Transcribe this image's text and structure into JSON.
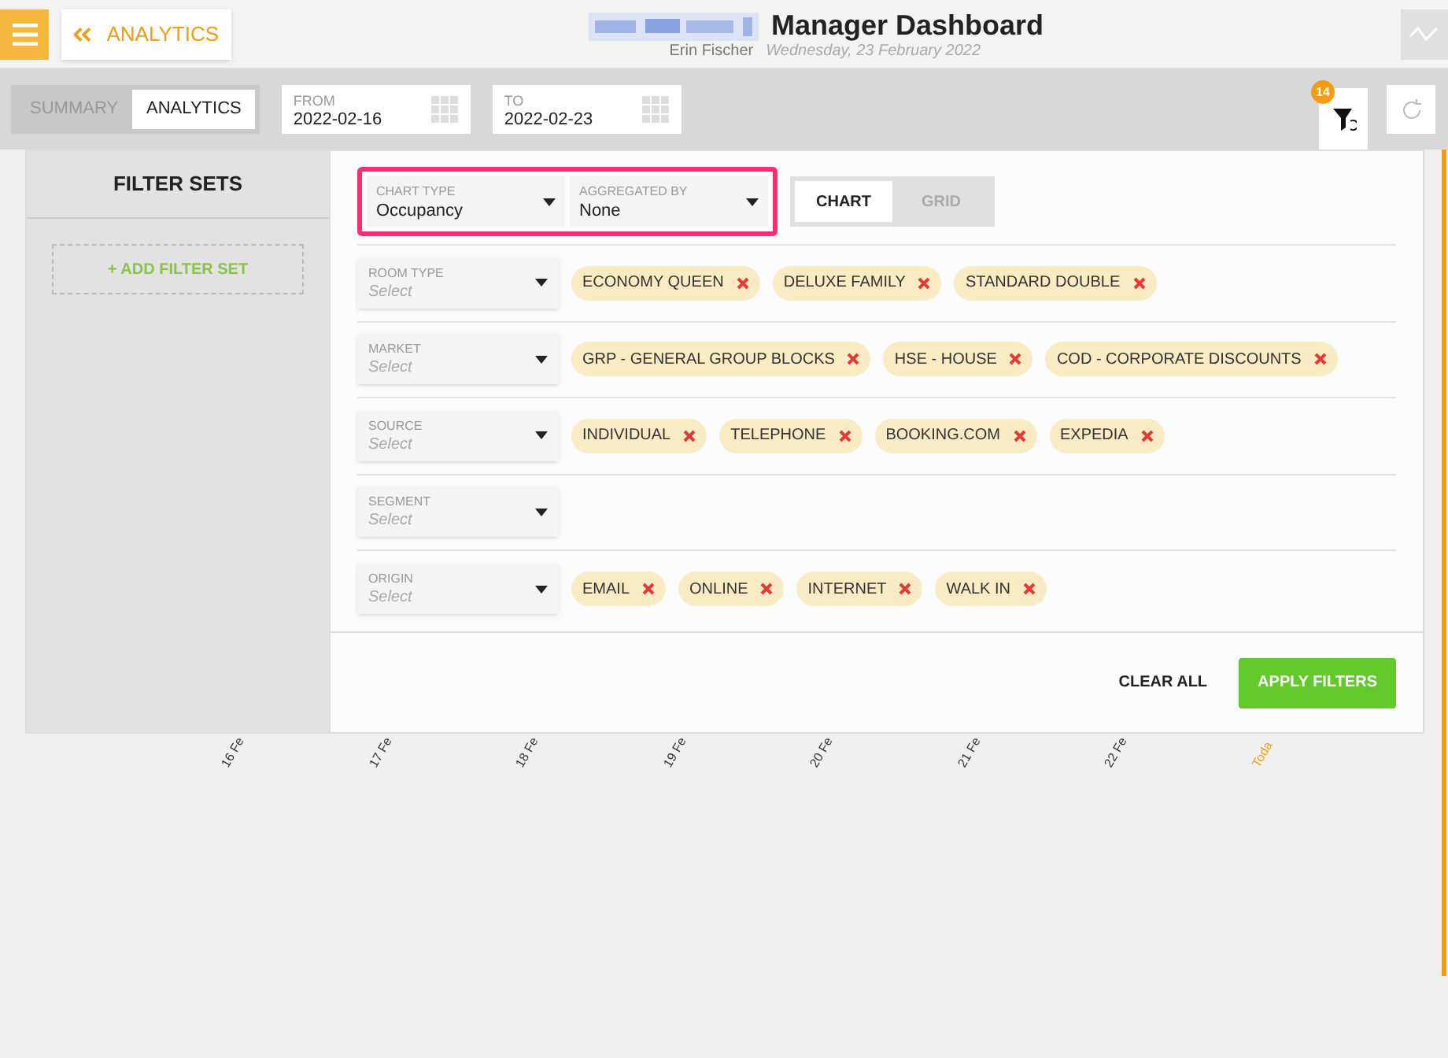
{
  "header": {
    "back_label": "ANALYTICS",
    "title": "Manager Dashboard",
    "user": "Erin Fischer",
    "date": "Wednesday, 23 February 2022"
  },
  "view_tabs": [
    {
      "label": "SUMMARY",
      "selected": false
    },
    {
      "label": "ANALYTICS",
      "selected": true
    }
  ],
  "date_from": {
    "label": "FROM",
    "value": "2022-02-16"
  },
  "date_to": {
    "label": "TO",
    "value": "2022-02-23"
  },
  "filter_badge": "14",
  "filter_sets": {
    "title": "FILTER SETS",
    "add_label": "+ ADD FILTER SET"
  },
  "chart_type": {
    "label": "CHART TYPE",
    "value": "Occupancy"
  },
  "aggregated_by": {
    "label": "AGGREGATED BY",
    "value": "None"
  },
  "display_tabs": [
    {
      "label": "CHART",
      "selected": true
    },
    {
      "label": "GRID",
      "selected": false
    }
  ],
  "filters": [
    {
      "label": "ROOM TYPE",
      "placeholder": "Select",
      "tags": [
        "ECONOMY QUEEN",
        "DELUXE FAMILY",
        "STANDARD DOUBLE"
      ]
    },
    {
      "label": "MARKET",
      "placeholder": "Select",
      "tags": [
        "GRP - GENERAL GROUP BLOCKS",
        "HSE - HOUSE",
        "COD - CORPORATE DISCOUNTS"
      ]
    },
    {
      "label": "SOURCE",
      "placeholder": "Select",
      "tags": [
        "INDIVIDUAL",
        "TELEPHONE",
        "BOOKING.COM",
        "EXPEDIA"
      ]
    },
    {
      "label": "SEGMENT",
      "placeholder": "Select"
    },
    {
      "label": "ORIGIN",
      "placeholder": "Select",
      "tags": [
        "EMAIL",
        "ONLINE",
        "INTERNET",
        "WALK IN"
      ]
    }
  ],
  "actions": {
    "clear": "CLEAR ALL",
    "apply": "APPLY FILTERS"
  },
  "axis_labels": [
    {
      "text": "16 Fe",
      "today": false
    },
    {
      "text": "17 Fe",
      "today": false
    },
    {
      "text": "18 Fe",
      "today": false
    },
    {
      "text": "19 Fe",
      "today": false
    },
    {
      "text": "20 Fe",
      "today": false
    },
    {
      "text": "21 Fe",
      "today": false
    },
    {
      "text": "22 Fe",
      "today": false
    },
    {
      "text": "Toda",
      "today": true
    }
  ]
}
